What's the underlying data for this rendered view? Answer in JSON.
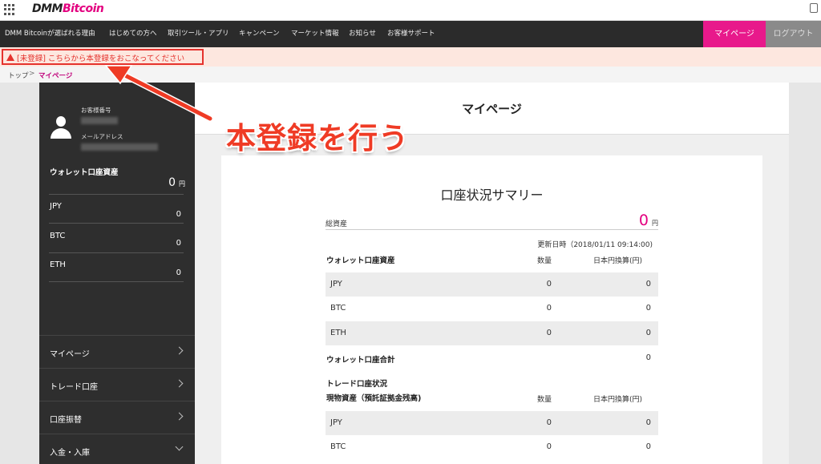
{
  "header": {
    "logo_prefix": "DMM",
    "logo_suffix": "Bitcoin"
  },
  "nav": {
    "items": [
      "DMM Bitcoinが選ばれる理由",
      "はじめての方へ",
      "取引ツール・アプリ",
      "キャンペーン",
      "マーケット情報",
      "お知らせ",
      "お客様サポート"
    ],
    "mypage": "マイページ",
    "logout": "ログアウト"
  },
  "alert": {
    "text": "[未登録] こちらから本登録をおこなってください"
  },
  "breadcrumb": {
    "top": "トップ",
    "separator": ">",
    "current": "マイページ"
  },
  "sidebar": {
    "customer_no_label": "お客様番号",
    "email_label": "メールアドレス",
    "wallet_title": "ウォレット口座資産",
    "wallet_amount": "0",
    "wallet_unit": "円",
    "coins": [
      {
        "name": "JPY",
        "value": "0"
      },
      {
        "name": "BTC",
        "value": "0"
      },
      {
        "name": "ETH",
        "value": "0"
      }
    ],
    "menu": [
      {
        "label": "マイページ"
      },
      {
        "label": "トレード口座"
      },
      {
        "label": "口座振替"
      },
      {
        "label": "入金・入庫"
      }
    ]
  },
  "main": {
    "title": "マイページ",
    "annotation": "本登録を行う"
  },
  "summary": {
    "title": "口座状況サマリー",
    "total_label": "総資産",
    "total_value": "0",
    "total_unit": "円",
    "updated": "更新日時（2018/01/11 09:14:00)",
    "col_qty": "数量",
    "col_jpy": "日本円換算(円)",
    "wallet_section": "ウォレット口座資産",
    "wallet_rows": [
      {
        "name": "JPY",
        "qty": "0",
        "jpy": "0"
      },
      {
        "name": "BTC",
        "qty": "0",
        "jpy": "0"
      },
      {
        "name": "ETH",
        "qty": "0",
        "jpy": "0"
      }
    ],
    "wallet_total_label": "ウォレット口座合計",
    "wallet_total_value": "0",
    "trade_section": "トレード口座状況",
    "spot_section": "現物資産（預託証拠金残高)",
    "spot_rows": [
      {
        "name": "JPY",
        "qty": "0",
        "jpy": "0"
      },
      {
        "name": "BTC",
        "qty": "0",
        "jpy": "0"
      }
    ]
  },
  "colors": {
    "accent": "#e8198b",
    "alert": "#e5322d",
    "nav_bg": "#2b2b2b",
    "sidebar_bg": "#2e2e2e",
    "annotation": "#ef3b25"
  }
}
